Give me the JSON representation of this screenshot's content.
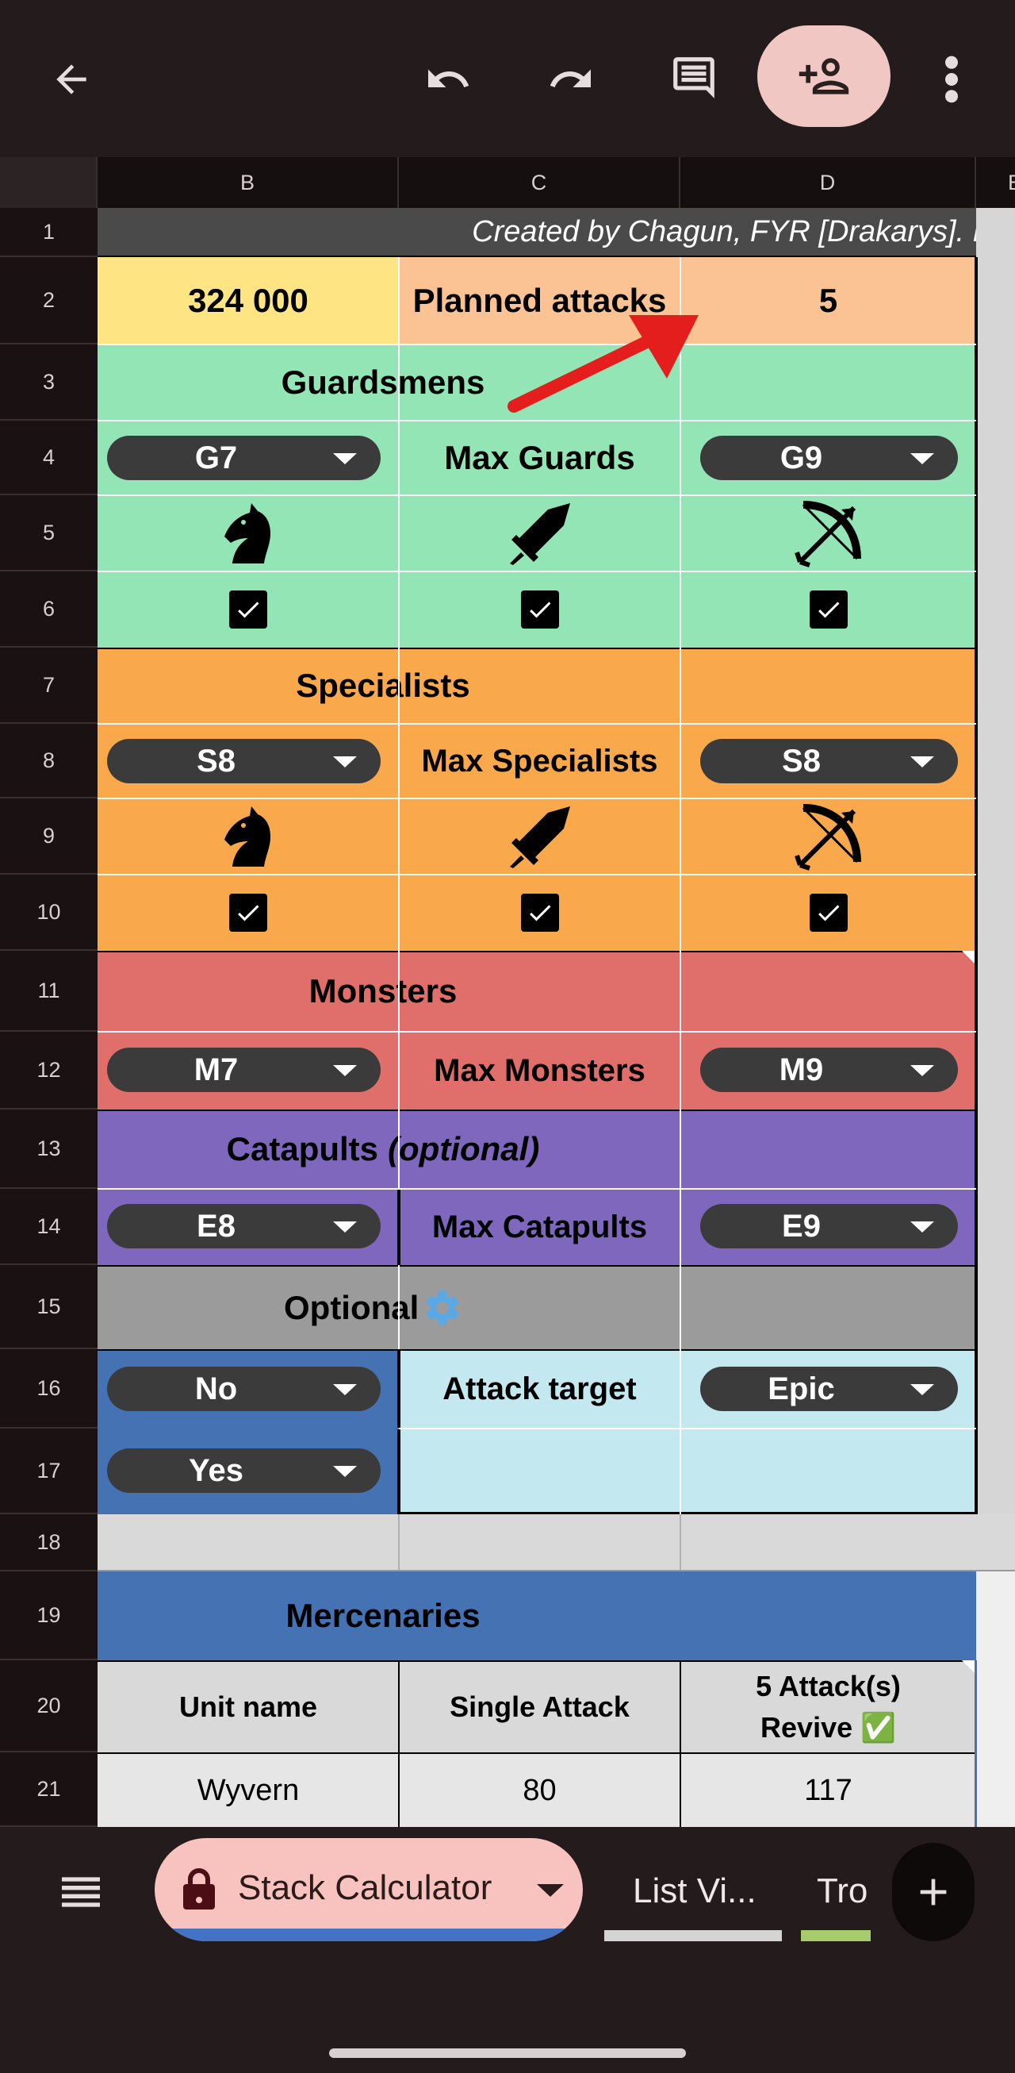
{
  "toolbar": {
    "back_icon": "arrow-left-icon",
    "undo_icon": "undo-icon",
    "redo_icon": "redo-icon",
    "comment_icon": "comment-icon",
    "share_icon": "add-person-icon",
    "more_icon": "more-vert-icon"
  },
  "columns": [
    "B",
    "C",
    "D",
    "E"
  ],
  "rows": [
    "1",
    "2",
    "3",
    "4",
    "5",
    "6",
    "7",
    "8",
    "9",
    "10",
    "11",
    "12",
    "13",
    "14",
    "15",
    "16",
    "17",
    "18",
    "19",
    "20",
    "21"
  ],
  "sheet": {
    "credit": "Created by Chagun, FYR [Drakarys]. Fo",
    "row2": {
      "value": "324 000",
      "label": "Planned attacks",
      "attacks": "5"
    },
    "guardsmens": {
      "title": "Guardsmens",
      "left": "G7",
      "middle": "Max Guards",
      "right": "G9",
      "icons": [
        "horse-icon",
        "sword-icon",
        "bow-icon"
      ]
    },
    "specialists": {
      "title": "Specialists",
      "left": "S8",
      "middle": "Max Specialists",
      "right": "S8",
      "icons": [
        "horse-icon",
        "sword-icon",
        "bow-icon"
      ]
    },
    "monsters": {
      "title": "Monsters",
      "left": "M7",
      "middle": "Max Monsters",
      "right": "M9"
    },
    "catapults": {
      "title": "Catapults",
      "title_optional": "(optional)",
      "left": "E8",
      "middle": "Max Catapults",
      "right": "E9"
    },
    "optional": {
      "title": "Optional",
      "title_icon": "gear-icon"
    },
    "row16": {
      "left": "No",
      "middle": "Attack target",
      "right": "Epic"
    },
    "row17": {
      "left": "Yes"
    },
    "mercenaries": {
      "title": "Mercenaries",
      "headers": [
        "Unit name",
        "Single Attack",
        "5 Attack(s)",
        "Revive ✅"
      ],
      "rows": [
        {
          "name": "Wyvern",
          "single": "80",
          "multi": "117"
        }
      ]
    }
  },
  "tabs": {
    "menu_icon": "sheets-list-icon",
    "active": "Stack Calculator",
    "lock_icon": "lock-icon",
    "others": [
      "List Vi...",
      "Tro"
    ],
    "add_icon": "plus-icon"
  },
  "colors": {
    "yellow": "#ffe484",
    "peach": "#fbc394",
    "green": "#93e5b6",
    "orange": "#f9a84c",
    "red": "#e06f6b",
    "purple": "#7f67bd",
    "gray": "#9b9b9b",
    "blue": "#4472b3",
    "light_blue": "#c4e8f0"
  }
}
